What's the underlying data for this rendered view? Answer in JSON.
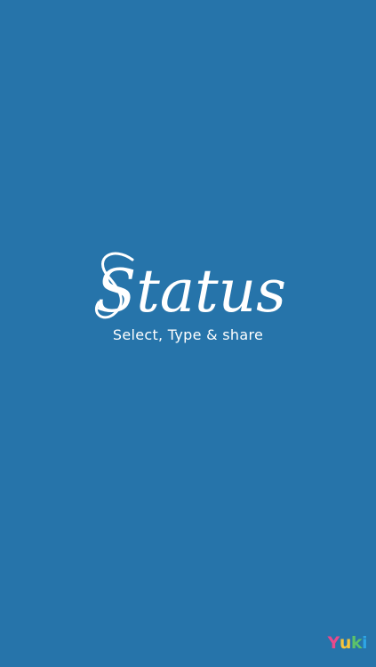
{
  "app": {
    "logo_text": "Status",
    "tagline": "Select, Type & share"
  },
  "developer": {
    "name": "Yuki",
    "letters": [
      "Y",
      "u",
      "k",
      "i"
    ],
    "letter_colors": [
      "#e94a8c",
      "#f6c53c",
      "#5cc26b",
      "#2ea6e6"
    ]
  },
  "colors": {
    "background": "#2674aa",
    "text": "#ffffff"
  }
}
